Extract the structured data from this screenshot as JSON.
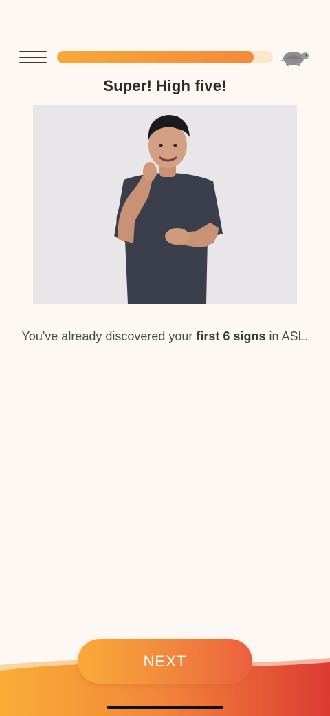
{
  "header": {
    "menu_icon": "hamburger-menu-icon",
    "progress_fraction": 0.91,
    "speed_icon": "turtle-icon"
  },
  "main": {
    "title": "Super! High five!",
    "video_subject": "person signing in ASL",
    "description": {
      "prefix": "You've already discovered your ",
      "emphasis": "first 6 signs",
      "suffix": " in ASL."
    }
  },
  "footer": {
    "next_label": "NEXT"
  },
  "colors": {
    "background": "#fdf8f3",
    "progress_fill": "#f4893a",
    "progress_track": "#fde7c9",
    "accent_start": "#f9ab38",
    "accent_end": "#ec5f3f"
  }
}
